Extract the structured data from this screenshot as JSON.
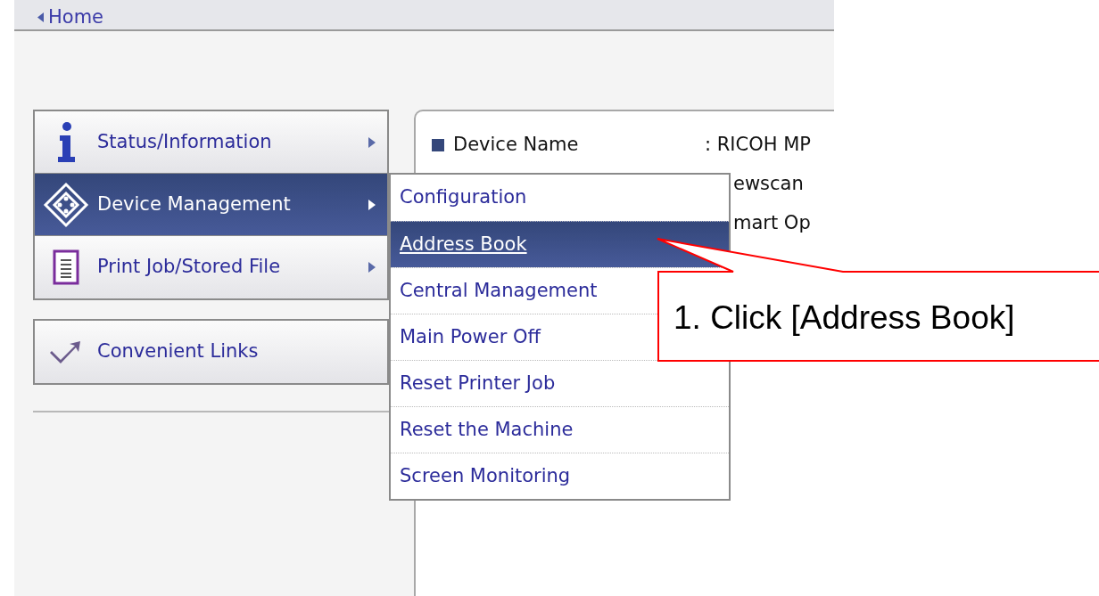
{
  "breadcrumb": {
    "label": "Home"
  },
  "nav_groups": [
    [
      {
        "label": "Status/Information",
        "kind": "info",
        "submenu": true,
        "selected": false
      },
      {
        "label": "Device Management",
        "kind": "diamond",
        "submenu": true,
        "selected": true
      },
      {
        "label": "Print Job/Stored File",
        "kind": "document",
        "submenu": true,
        "selected": false
      }
    ],
    [
      {
        "label": "Convenient Links",
        "kind": "link",
        "submenu": false,
        "selected": false
      }
    ]
  ],
  "info_rows": [
    {
      "label": "Device Name",
      "value": ": RICOH MP"
    },
    {
      "value": "ewscan"
    },
    {
      "value": "mart Op"
    }
  ],
  "submenu": [
    {
      "label": "Configuration",
      "selected": false
    },
    {
      "label": "Address Book",
      "selected": true
    },
    {
      "label": "Central Management",
      "selected": false
    },
    {
      "label": "Main Power Off",
      "selected": false
    },
    {
      "label": "Reset Printer Job",
      "selected": false
    },
    {
      "label": "Reset the Machine",
      "selected": false
    },
    {
      "label": "Screen Monitoring",
      "selected": false
    }
  ],
  "callout": {
    "text": "1. Click [Address Book]"
  }
}
